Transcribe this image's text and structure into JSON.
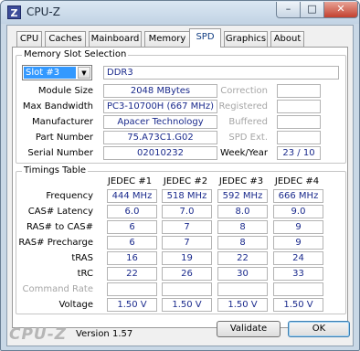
{
  "window": {
    "title": "CPU-Z",
    "icon_letter": "Z",
    "controls": {
      "minimize": "–",
      "maximize": "□",
      "close": "✕"
    }
  },
  "tabs": [
    "CPU",
    "Caches",
    "Mainboard",
    "Memory",
    "SPD",
    "Graphics",
    "About"
  ],
  "active_tab": "SPD",
  "slot_section": {
    "title": "Memory Slot Selection",
    "slot_selected": "Slot #3",
    "memory_type": "DDR3",
    "fields": [
      {
        "label": "Module Size",
        "value": "2048 MBytes"
      },
      {
        "label": "Max Bandwidth",
        "value": "PC3-10700H (667 MHz)"
      },
      {
        "label": "Manufacturer",
        "value": "Apacer Technology"
      },
      {
        "label": "Part Number",
        "value": "75.A73C1.G02"
      },
      {
        "label": "Serial Number",
        "value": "02010232"
      }
    ],
    "right_fields": [
      {
        "label": "Correction",
        "value": ""
      },
      {
        "label": "Registered",
        "value": ""
      },
      {
        "label": "Buffered",
        "value": ""
      },
      {
        "label": "SPD Ext.",
        "value": ""
      },
      {
        "label": "Week/Year",
        "value": "23 / 10"
      }
    ]
  },
  "timings": {
    "title": "Timings Table",
    "columns": [
      "JEDEC #1",
      "JEDEC #2",
      "JEDEC #3",
      "JEDEC #4"
    ],
    "rows": [
      {
        "label": "Frequency",
        "values": [
          "444 MHz",
          "518 MHz",
          "592 MHz",
          "666 MHz"
        ]
      },
      {
        "label": "CAS# Latency",
        "values": [
          "6.0",
          "7.0",
          "8.0",
          "9.0"
        ]
      },
      {
        "label": "RAS# to CAS#",
        "values": [
          "6",
          "7",
          "8",
          "9"
        ]
      },
      {
        "label": "RAS# Precharge",
        "values": [
          "6",
          "7",
          "8",
          "9"
        ]
      },
      {
        "label": "tRAS",
        "values": [
          "16",
          "19",
          "22",
          "24"
        ]
      },
      {
        "label": "tRC",
        "values": [
          "22",
          "26",
          "30",
          "33"
        ]
      },
      {
        "label": "Command Rate",
        "values": [
          "",
          "",
          "",
          ""
        ]
      },
      {
        "label": "Voltage",
        "values": [
          "1.50 V",
          "1.50 V",
          "1.50 V",
          "1.50 V"
        ]
      }
    ]
  },
  "footer": {
    "brand": "CPU-Z",
    "version": "Version 1.57",
    "validate_label": "Validate",
    "ok_label": "OK"
  }
}
